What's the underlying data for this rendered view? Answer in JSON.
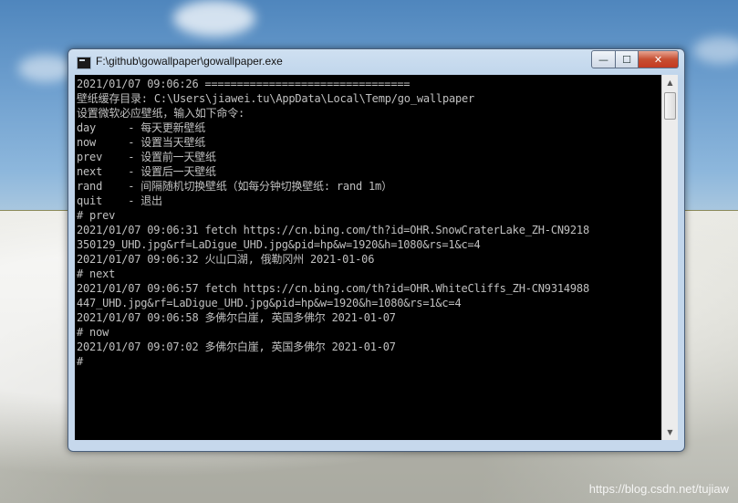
{
  "window": {
    "title": "F:\\github\\gowallpaper\\gowallpaper.exe",
    "controls": {
      "minimize": "—",
      "maximize": "☐",
      "close": "✕"
    }
  },
  "console": {
    "lines": [
      "2021/01/07 09:06:26 ================================",
      "壁纸缓存目录: C:\\Users\\jiawei.tu\\AppData\\Local\\Temp/go_wallpaper",
      "设置微软必应壁纸，输入如下命令:",
      "day     - 每天更新壁纸",
      "now     - 设置当天壁纸",
      "prev    - 设置前一天壁纸",
      "next    - 设置后一天壁纸",
      "rand    - 间隔随机切换壁纸（如每分钟切换壁纸: rand 1m）",
      "quit    - 退出",
      "# prev",
      "2021/01/07 09:06:31 fetch https://cn.bing.com/th?id=OHR.SnowCraterLake_ZH-CN9218",
      "350129_UHD.jpg&rf=LaDigue_UHD.jpg&pid=hp&w=1920&h=1080&rs=1&c=4",
      "2021/01/07 09:06:32 火山口湖, 俄勒冈州 2021-01-06",
      "# next",
      "2021/01/07 09:06:57 fetch https://cn.bing.com/th?id=OHR.WhiteCliffs_ZH-CN9314988",
      "447_UHD.jpg&rf=LaDigue_UHD.jpg&pid=hp&w=1920&h=1080&rs=1&c=4",
      "2021/01/07 09:06:58 多佛尔白崖, 英国多佛尔 2021-01-07",
      "# now",
      "2021/01/07 09:07:02 多佛尔白崖, 英国多佛尔 2021-01-07",
      "#"
    ]
  },
  "scrollbar": {
    "up": "▲",
    "down": "▼"
  },
  "watermark": "https://blog.csdn.net/tujiaw"
}
